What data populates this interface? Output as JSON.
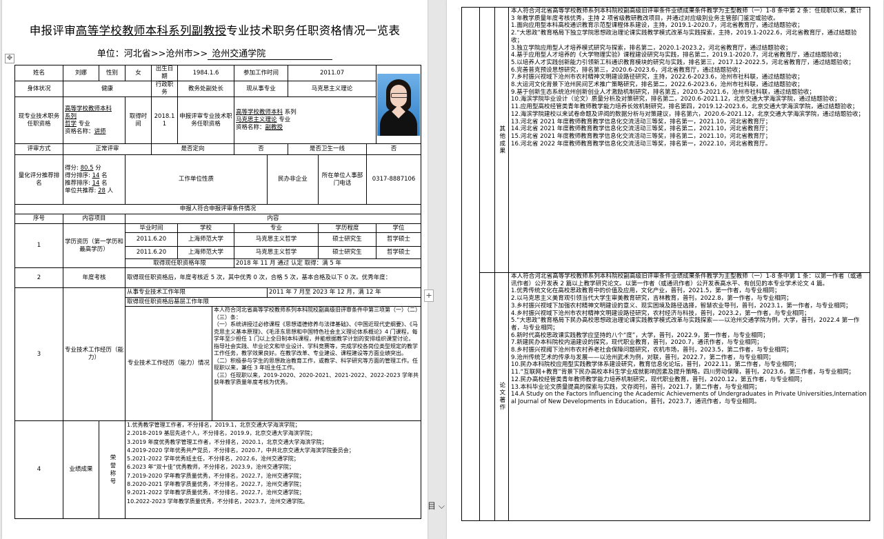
{
  "page1": {
    "title_pre": "申报评审",
    "title_ul1": "高等学校教师本科系列副教授",
    "title_post": "专业技术职务任职资格情况一览表",
    "unit_label": "单位：",
    "unit_pre": "河北省>>沧州市>>",
    "unit_name": "沧州交通学院",
    "basic": {
      "name_label": "姓名",
      "name": "刘娜",
      "gender_label": "性别",
      "gender": "女",
      "birth_label": "出生日期",
      "birth": "1984.1.6",
      "work_label": "参加工作时间",
      "work": "2011.07",
      "health_label": "身体状况",
      "health": "健康",
      "duty_label": "行政职务",
      "duty": "教务处副处长",
      "major_label": "现从事专业",
      "major": "马克思主义理论"
    },
    "current": {
      "label": "现专业技术职务任职资格",
      "l1": "高等学校教师本科",
      "l2": "系列",
      "l3a": "哲学",
      "l3b": "专业",
      "l4a": "资格名称：",
      "l4b": "讲师",
      "time_label": "取得时间",
      "time": "2018.11",
      "apply_label": "申报评审专业技术职务任职资格",
      "a1": "高等学校教师本科",
      "a1b": "系列",
      "a2": "马克思主义理论",
      "a2b": "专业",
      "a3a": "资格名称：",
      "a3b": "副教授"
    },
    "review": {
      "mode_label": "评审方式",
      "mode": "正常评审",
      "direct_label": "是否定向",
      "direct": "否",
      "health_label": "是否卫生一线",
      "health": "否"
    },
    "score": {
      "label": "量化评分推荐排名",
      "s1a": "得分:",
      "s1b": "80.5",
      "s1c": "分",
      "s2a": "得分排序:",
      "s2b": "14",
      "s2c": "名",
      "s3a": "推荐排序:",
      "s3b": "14",
      "s3c": "名",
      "s4a": "单位共推荐:",
      "s4b": "28",
      "s4c": "人",
      "unit_nature_label": "工作单位性质",
      "unit_nature": "民办非企业",
      "phone_label": "所在单位人事部门电话",
      "phone": "0317-8887106"
    },
    "section_header": "申报人符合申报评审条件情况",
    "cond_headers": {
      "no": "序号",
      "item": "内容项目",
      "content": "内容"
    },
    "edu": {
      "no": "1",
      "item": "学历资历（第一学历和最高学历）",
      "h": [
        "毕业时间",
        "学校",
        "专业",
        "学历程度",
        "学位"
      ],
      "rows": [
        [
          "2011.6.20",
          "上海师范大学",
          "马克思主义哲学",
          "硕士研究生",
          "哲学硕士"
        ],
        [
          "2011.6.20",
          "上海师范大学",
          "马克思主义哲学",
          "硕士研究生",
          "哲学硕士"
        ]
      ],
      "limit_label": "取得现任职资格年限",
      "limit": "2018 年 11 月 通过 认定 取得：满 5 年"
    },
    "yearly": {
      "no": "2",
      "item": "年度考核",
      "text": "取得现任职资格后，年度考核近 5 次，其中优秀 0 次，合格 5 次，基本合格及以下 0 次。优秀年度："
    },
    "experience": {
      "no": "3",
      "item": "专业技术工作经历（能力）",
      "years_label": "从事专业技术工作年限",
      "years": "2011 年 7 月至 2023 年 12 月，满 12 年",
      "main_label": "取得现任职资格后基层工作年限",
      "detail_label": "专业技术工作经历（能力）情况",
      "detail": "本人符合河北省高等学校教师系列本科院校副高级旧评审条件中第三项第（一）（二）（三）条：\n（一）系统讲授过必修课程《思想道德修养与法律基础》、《中国近现代史纲要》、《马克思主义基本原理》、《毛泽东思想和中国特色社会主义理论体系概论》4 门课程，每学年至少担任 1 门以上全日制本科课程，并能根据教学计划的安排组织课堂讨论，指导社会实践、毕业论文和毕业设计、学科竞赛等，完成学校各岗位类型规定的教学工作任务，教学效果良好。在教学改革、专业建设、课程建设等方面业绩突出。\n（二）积极参与学生的思想政治教育工作，或教学、科学研究等方面的管理工作。任现职以来，兼任 3 年班主任工作。\n（三）任现职以来，2019-2020、2020-2021、2021-2022、2022-2023 学年共获年教学质量年度考核为优秀。"
    },
    "achieve": {
      "no": "4",
      "item": "业绩成果",
      "sub": "荣誉称号",
      "lines": [
        "1.优秀教学管理工作者，不分排名，2019.1，北京交通大学海滨学院；",
        "2.2018-2019 基层先进个人，不分排名，2019.9，北京交通大学海滨学院；",
        "3.2019 年度优秀教学管理工作者，不分排名，2020.1，北京交通大学海滨学院；",
        "4.2019-2020 学年优秀共产党员，不分排名，2020.7，中共北京交通大学海滨学院委员会；",
        "5.2021-2022 学年优秀班主任，不分排名，2022.6，沧州交通学院；",
        "6.2023 年“双十佳”优秀教师，不分排名，2023.9，沧州交通学院；",
        "7.2019-2020 学年教学质量优秀，不分排名，2022.7，沧州交通学院；",
        "8.2020-2021 学年教学质量优秀，不分排名，2022.7，沧州交通学院；",
        "9.2021-2022 学年教学质量优秀，不分排名，2022.7，沧州交通学院；",
        "10.2022-2023 学年教学质量优秀，不分排名，2023.7，沧州交通学院。"
      ]
    }
  },
  "page2": {
    "other": {
      "label": "其他成果",
      "lines": [
        "本人符合河北省高等学校教师系列本科院校副高级旧评审条件业绩成果条件教学为主型教师（一）1-8 条中第 2 条：任现职以来，累计 3 年教学质量年度考核优秀，主持 2 项省级教研教改项目，并通过对应级别业务主管部门鉴定或验收。",
        "1.面向应用型本科高校通识教育示范型课程体系建设，主持，2019.1-2020.7，河北省教育厅，通过结题验收；",
        "2.“大思政”教育格局下独立学院思想政治理论课实践教学模式改革与实践探索，主持，2019.1-2022.6，河北省教育厅，通过结题验收；",
        "3.独立学院应用型人才培养模式研究与探索，排名第二，2020.1-2023.2，河北省教育厅，通过结题验收；",
        "4.基于应用型人才培养的《大学物理实验》课程建设研究与实践，排名第二，2019.1-2020.7，河北省教育厅，通过结题验收；",
        "5.以培养人才实践创新能力引领新工科通识教育模块的研究与实践，排名第三，2017.12-2022.5，河北省教育厅，通过结题验收；",
        "6.完善普克预设思想研究，排名第三，2020.6-2023.6，河北省教育厅，通过结题验收；",
        "7.乡村振兴视域下沧州市农村精神文明建设路径研究，主持，2022.6-2023.6，沧州市社科联，通过结题验收；",
        "8.大运河文化背景下沧州民间艺术推广策略研究，排名第二，2022.6-2023.6，沧州市社科联，通过结题验收；",
        "9.基于创新生态系统沧州创新创业人才激励机制研究，排名第五，2020.5-2021.6，沧州市社科联，通过结题验收；",
        "10.海滨学院毕业设计（论文）质量分析及对策研究，排名第二，2020.6-2021.12，北京交通大学海滨学院，通过结题验收；",
        "11.应用型高校经管类青年教师教学能力培养长效机制研究，排名第四，2019.12-2023.6，北京交通大学海滨学院，通过结题验收；",
        "12.海滨学院建校以来试卷命题及评阅的数据分析与对策建议，排名第六，2020.6-2021.12，北京交通大学海滨学院，通过结题验收；",
        "13.河北省 2021 年度教师教育教学信息化交流活动三等奖，排名第一，2021.10，河北省教育厅；",
        "14.河北省 2021 年度教师教育教学信息化交流活动三等奖，排名第二，2021.10，河北省教育厅；",
        "15.河北省 2021 年度教师教育教学信息化交流活动三等奖，排名第二，2021.10，河北省教育厅；",
        "16.河北省 2022 年度教师教育教学信息化交流活动三等奖，排名第一，2022.10，河北省教育厅。"
      ]
    },
    "papers": {
      "label": "论文著作",
      "lines": [
        "本人符合河北省高等学校教师系列本科院校副高级旧评审条件业绩成果条件教学为主型教师（一）1-8 条中第 1 条：以第一作者（或通讯作者）公开发表 2 篇以上教学研究论文。以第一作者（或通讯作者）公开发表高水平、有创见的本专业学术论文 4 篇。",
        "1.优秀传统文化在高校思政教育中的价值及应用，文化产业，普刊，2021.5，第一作者，与专业相同；",
        "2.以马克思主义美育观引领当代大学生审美教育研究，吉林教育，普刊，2022.8，第一作者，与专业相同；",
        "3.乡村振兴视域下加强农村精神文明建设的意义、现实困境及路径选择，智慧农业导刊，普刊，2023.1，第一作者，与专业相同；",
        "4.乡村振兴视域下沧州市农村精神文明建设路径研究，农村经济与科技，普刊，2023.2，第一作者，与专业相同；",
        "5.“大思政”教育格局下民办高校思想政治理论课实践教学模式改革与实践探索——以沧州交通学院为例，大学，普刊，2022.4 第一作者，与专业相同；",
        "6.新时代高校思政课实践教学应坚持的八个“度”，大学，普刊，2022.9，第一作者，与专业相同；",
        "7.新建民办本科院校内涵建设的探究，现代职业教育，普刊，2020.7，通讯作者，与专业相同；",
        "8.乡村振兴视阈下沧州市农村养老社会保障问题研究，农机市场，普刊，2023.5，第二作者，与专业相同；",
        "9.沧州传统艺术的传承与发展——以沧州武术为例，对联，普刊，2022.7，第二作者，与专业相同；",
        "10.民办本科院校应用型实践教学体系建设研究，教育信息化论坛，普刊，2022.11，第二作者，与专业相同；",
        "11.“互联网+教育”背景下民办高校本科生学业成就影响因素及提升策略，四川劳动保障，普刊，2023.6，第三作者，与专业相同；",
        "12.民办高校经管类青年教师教学能力培养机制研究，现代职业教育，普刊，2020.12，第五作者，与专业相同；",
        "13.本科毕业论文质量提高的探索与实践，文存阅刊，普刊，2021.7，第二作者，与专业相同；",
        "14.A Study on the Factors Influencing the Academic Achievements of Undergraduates in Private Universities,International Journal of New Developments in Education，普刊，2023.7，通讯作者，与专业相同。"
      ]
    }
  },
  "ui": {
    "side_ctl": "+",
    "corner_ctl": "目 ⌵",
    "handle": "✥"
  }
}
